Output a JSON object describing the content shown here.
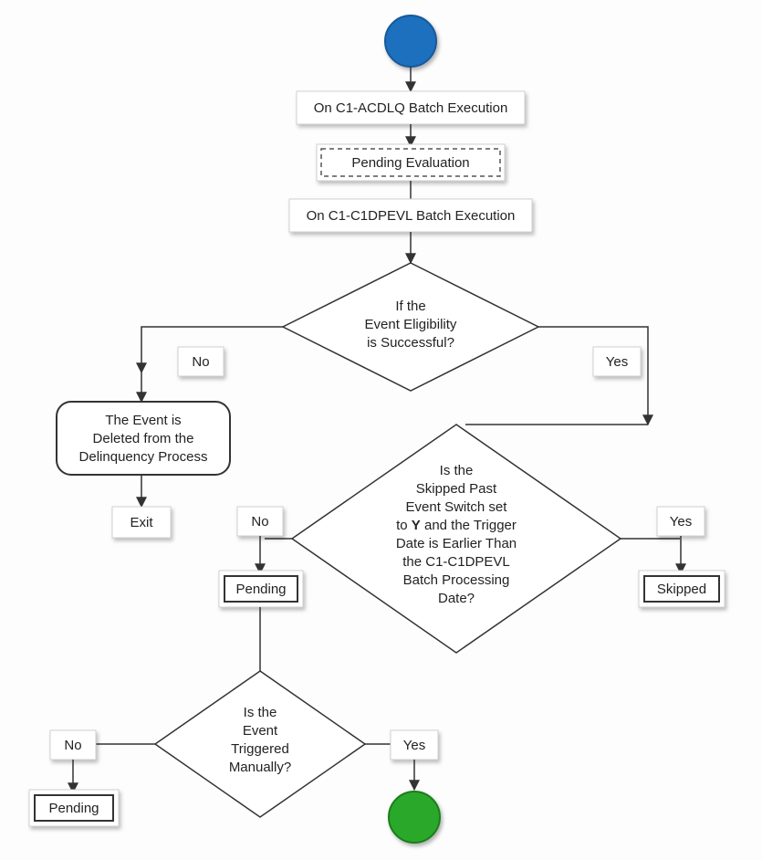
{
  "nodes": {
    "step1": "On C1-ACDLQ Batch Execution",
    "step2": "Pending Evaluation",
    "step3": "On C1-C1DPEVL Batch Execution",
    "d1_l1": "If the",
    "d1_l2": "Event Eligibility",
    "d1_l3": "is Successful?",
    "no1": "No",
    "yes1": "Yes",
    "del_l1": "The Event is",
    "del_l2": "Deleted from the",
    "del_l3": "Delinquency Process",
    "exit": "Exit",
    "d2_l1": "Is the",
    "d2_l2": "Skipped Past",
    "d2_l3": "Event Switch set",
    "d2_l4a": "to ",
    "d2_l4b": "Y",
    "d2_l4c": " and the Trigger",
    "d2_l5": "Date is Earlier Than",
    "d2_l6": "the C1-C1DPEVL",
    "d2_l7": "Batch Processing",
    "d2_l8": "Date?",
    "no2": "No",
    "yes2": "Yes",
    "skipped": "Skipped",
    "pending1": "Pending",
    "d3_l1": "Is the",
    "d3_l2": "Event",
    "d3_l3": "Triggered",
    "d3_l4": "Manually?",
    "no3": "No",
    "yes3": "Yes",
    "pending2": "Pending"
  }
}
